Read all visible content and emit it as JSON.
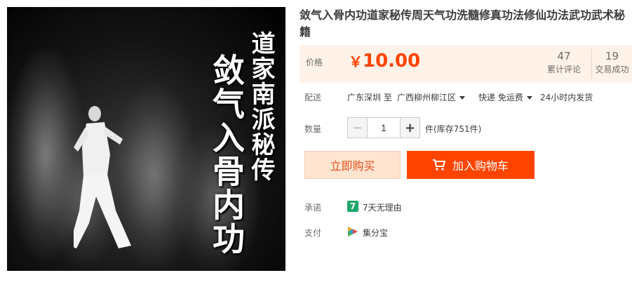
{
  "product": {
    "title": "敛气入骨内功道家秘传周天气功洗髓修真功法修仙功法武功武术秘籍",
    "image": {
      "text_sub": "道家南派秘传",
      "text_main": "敛气入骨内功"
    }
  },
  "price": {
    "label": "价格",
    "currency": "￥",
    "value": "10.00"
  },
  "stats": {
    "reviews_count": "47",
    "reviews_label": "累计评论",
    "sales_count": "19",
    "sales_label": "交易成功"
  },
  "shipping": {
    "label": "配送",
    "from": "广东深圳 至",
    "to": "广西柳州柳江区",
    "method": "快递 免运费",
    "dispatch": "24小时内发货"
  },
  "quantity": {
    "label": "数量",
    "value": "1",
    "minus": "−",
    "plus": "+",
    "stock": "件(库存751件)"
  },
  "actions": {
    "buy_now": "立即购买",
    "add_cart": "加入购物车"
  },
  "promise": {
    "label": "承诺",
    "icon_text": "7",
    "text": "7天无理由"
  },
  "payment": {
    "label": "支付",
    "text": "集分宝"
  },
  "colors": {
    "accent": "#ff4400",
    "price_bg": "#fff2e8",
    "buy_now_bg": "#ffe4d0",
    "promise_green": "#20a66a"
  }
}
